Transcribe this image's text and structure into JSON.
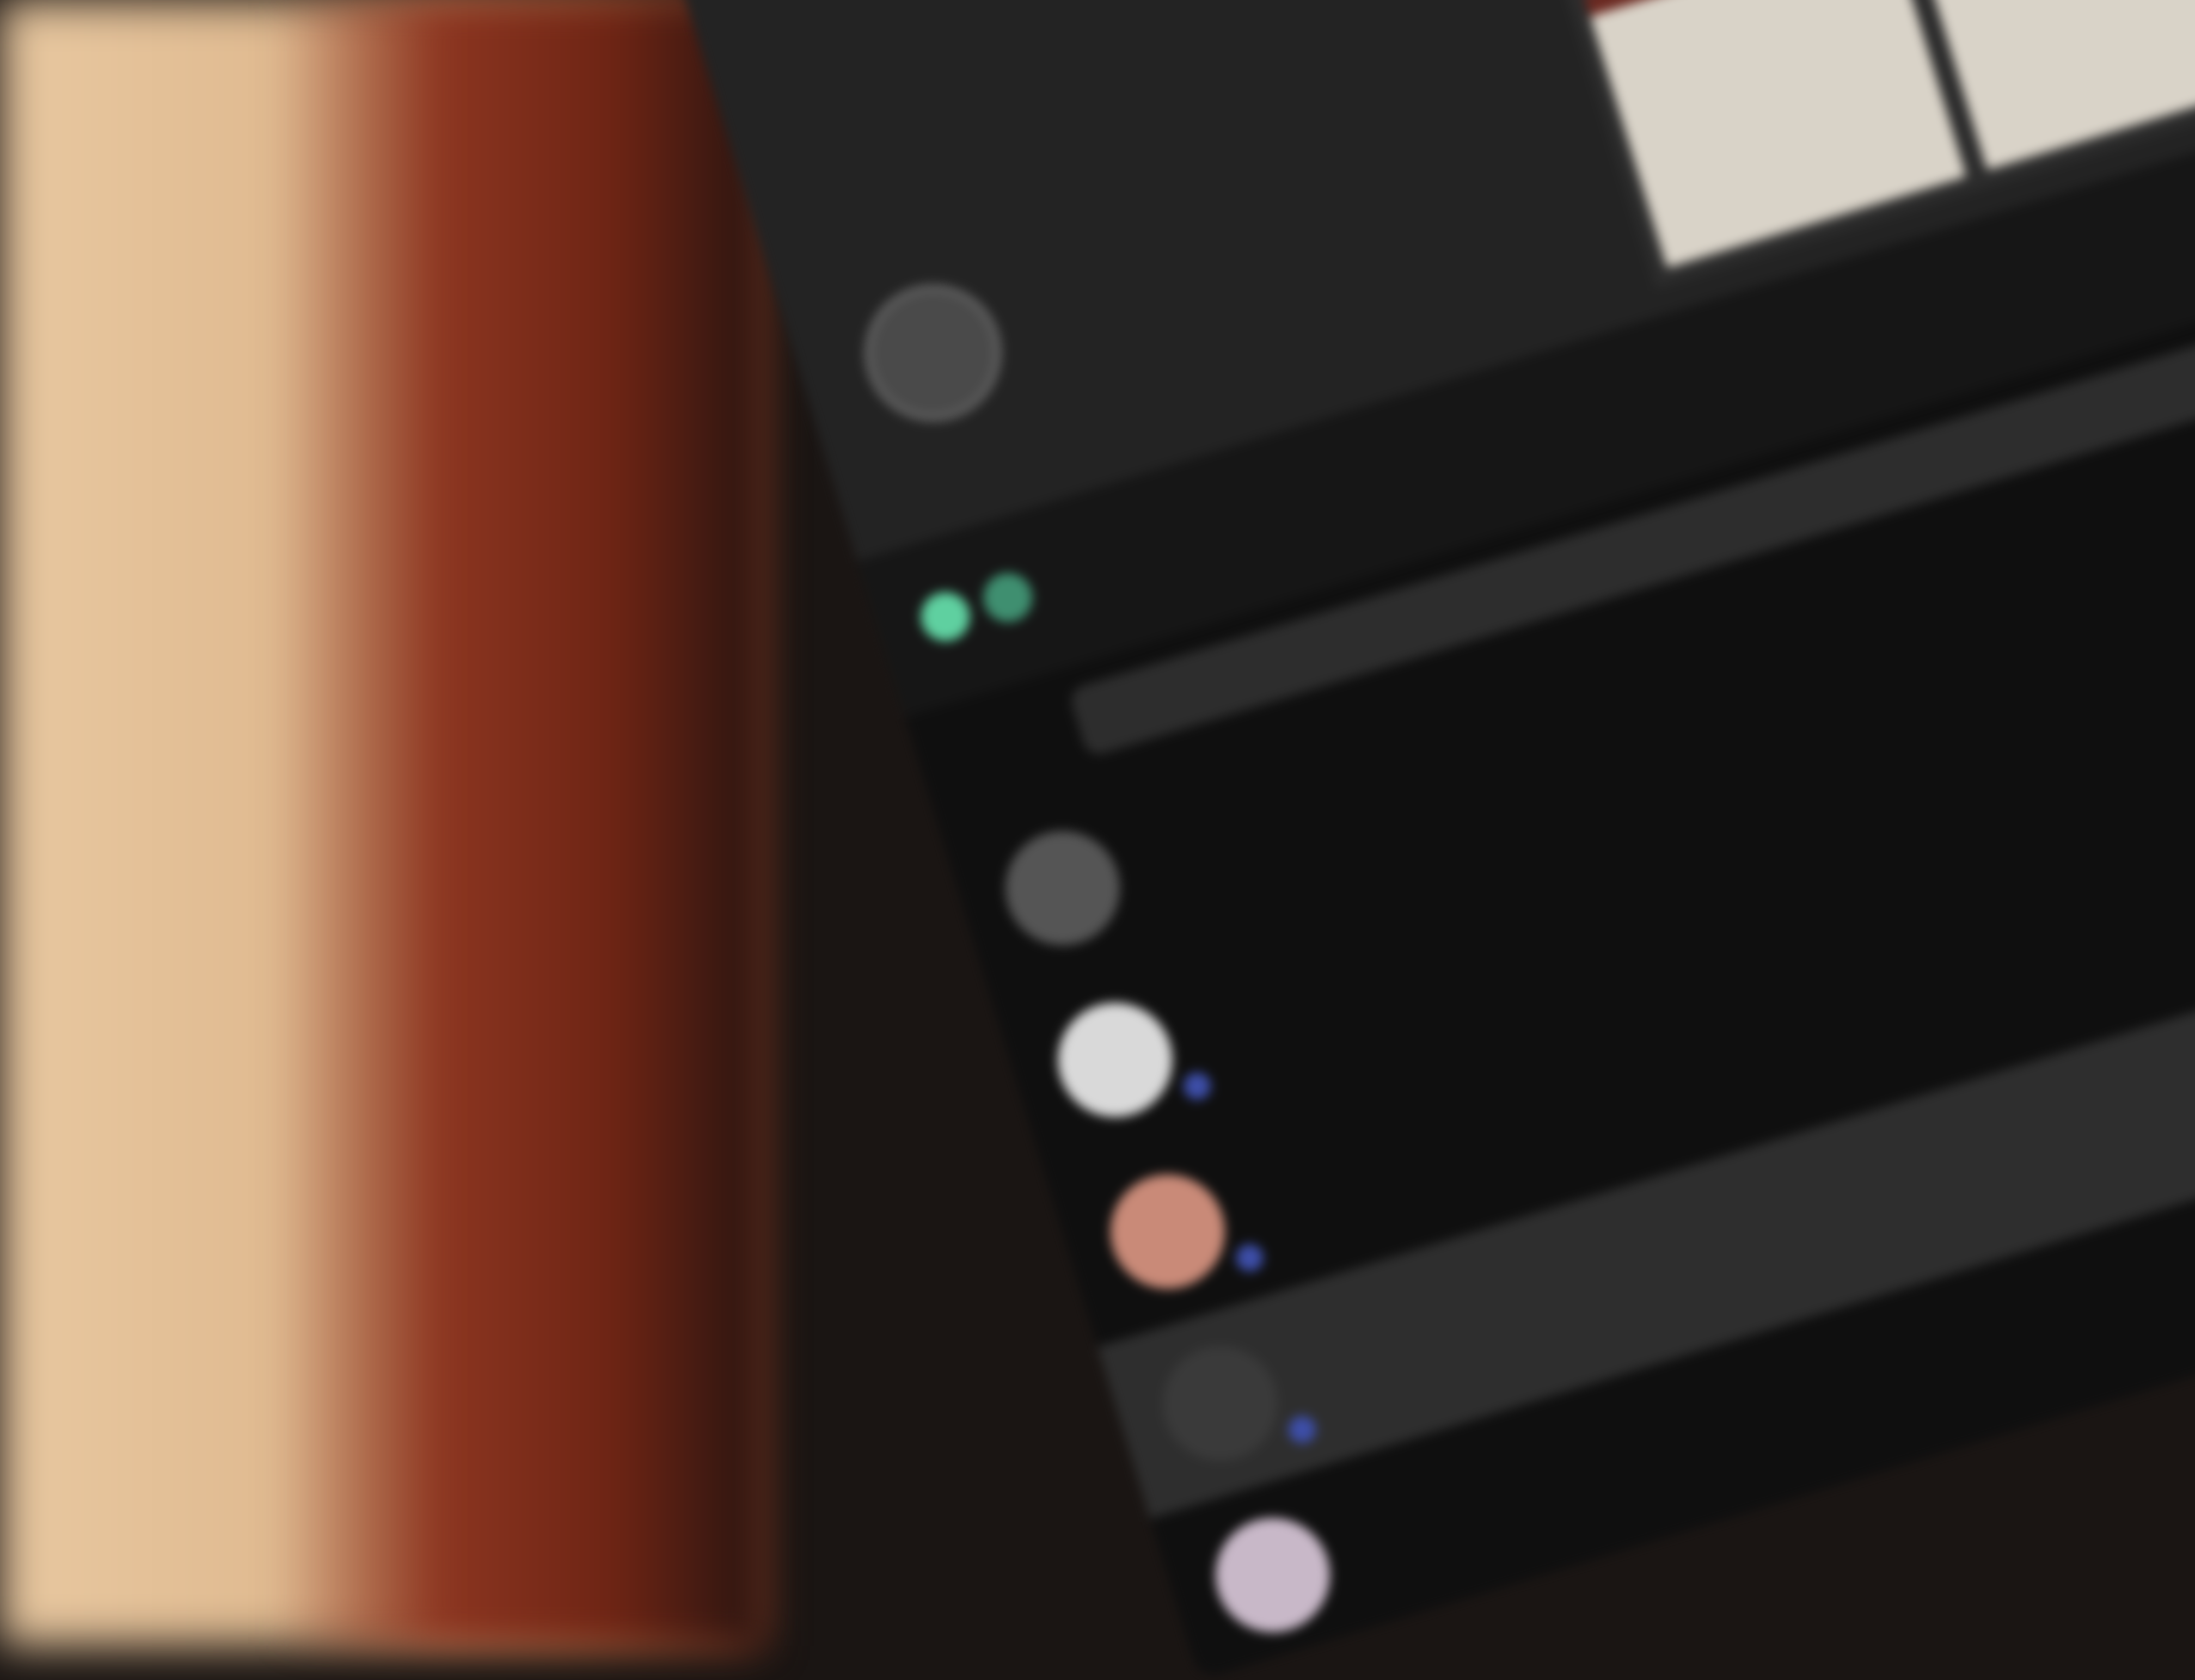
{
  "scene": {
    "wall_color": "#e8c8a0",
    "desk_color": "#8b3520"
  },
  "screen": {
    "stories": {
      "avatar_icon": "story-avatar-icon",
      "label": "",
      "thumbnails": [
        {
          "tone": "light"
        },
        {
          "tone": "dark"
        },
        {
          "tone": "light"
        },
        {
          "tone": "light"
        }
      ]
    },
    "feed": {
      "search_placeholder": "",
      "messages": [
        {
          "name": "",
          "preview": "",
          "time": "",
          "selected": false,
          "unread": false
        },
        {
          "name": "",
          "preview": "",
          "time": "",
          "selected": false,
          "unread": true
        },
        {
          "name": "",
          "preview": "",
          "time": "",
          "selected": false,
          "unread": true
        },
        {
          "name": "",
          "preview": "",
          "time": "",
          "selected": true,
          "unread": true
        },
        {
          "name": "",
          "preview": "",
          "time": "",
          "selected": false,
          "unread": false
        },
        {
          "name": "",
          "preview": "",
          "time": "",
          "selected": false,
          "unread": false
        }
      ]
    },
    "colors": {
      "accent_green": "#5fd0a0",
      "unread_blue": "#3d4ea8",
      "selected_row": "#2e2e2e",
      "background": "#121212"
    }
  }
}
